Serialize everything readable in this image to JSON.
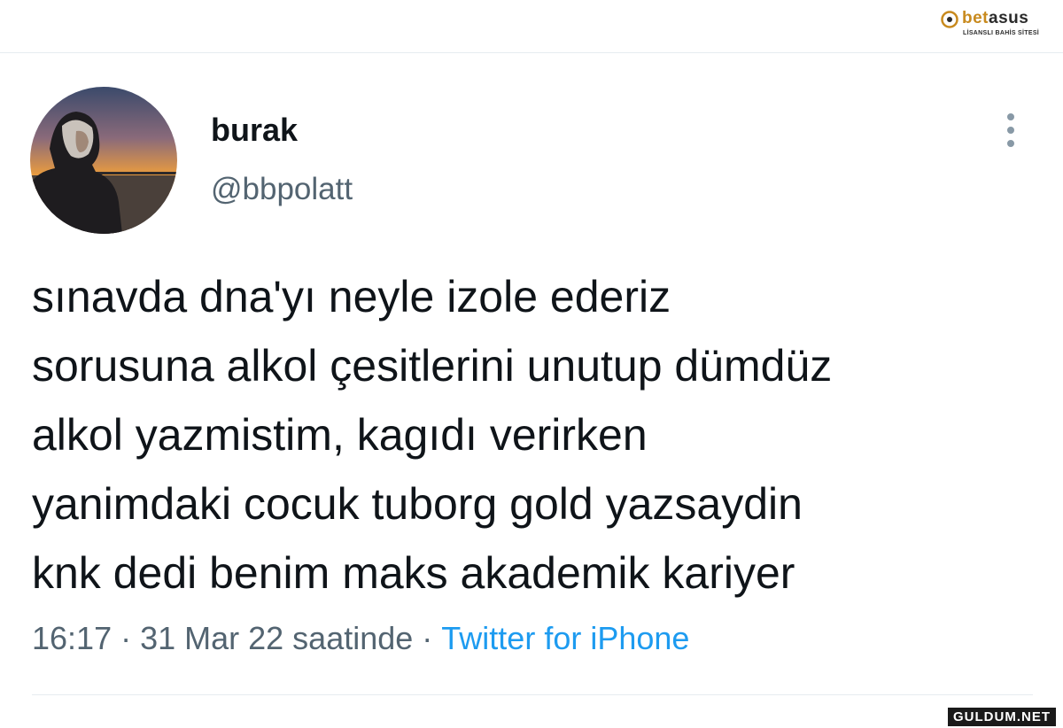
{
  "watermark_top": {
    "brand_prefix": "bet",
    "brand_suffix": "asus",
    "tagline": "LİSANSLI BAHİS SİTESİ"
  },
  "tweet": {
    "display_name": "burak",
    "username": "@bbpolatt",
    "text_lines": [
      "sınavda dna'yı neyle izole ederiz",
      "sorusuna alkol çesitlerini unutup dümdüz",
      "alkol yazmistim, kagıdı verirken",
      "yanimdaki cocuk tuborg gold yazsaydin",
      "knk dedi benim maks akademik kariyer"
    ],
    "time": "16:17",
    "separator": "·",
    "date": "31 Mar 22 saatinde",
    "source": "Twitter for iPhone"
  },
  "watermark_bottom": {
    "text": "GULDUM.NET"
  },
  "icons": {
    "more": "more-vertical-icon",
    "logo": "betasus-logo-icon"
  },
  "colors": {
    "name": "#0f1419",
    "secondary": "#536471",
    "link": "#1d9bf0",
    "divider": "#e6ecf0"
  }
}
